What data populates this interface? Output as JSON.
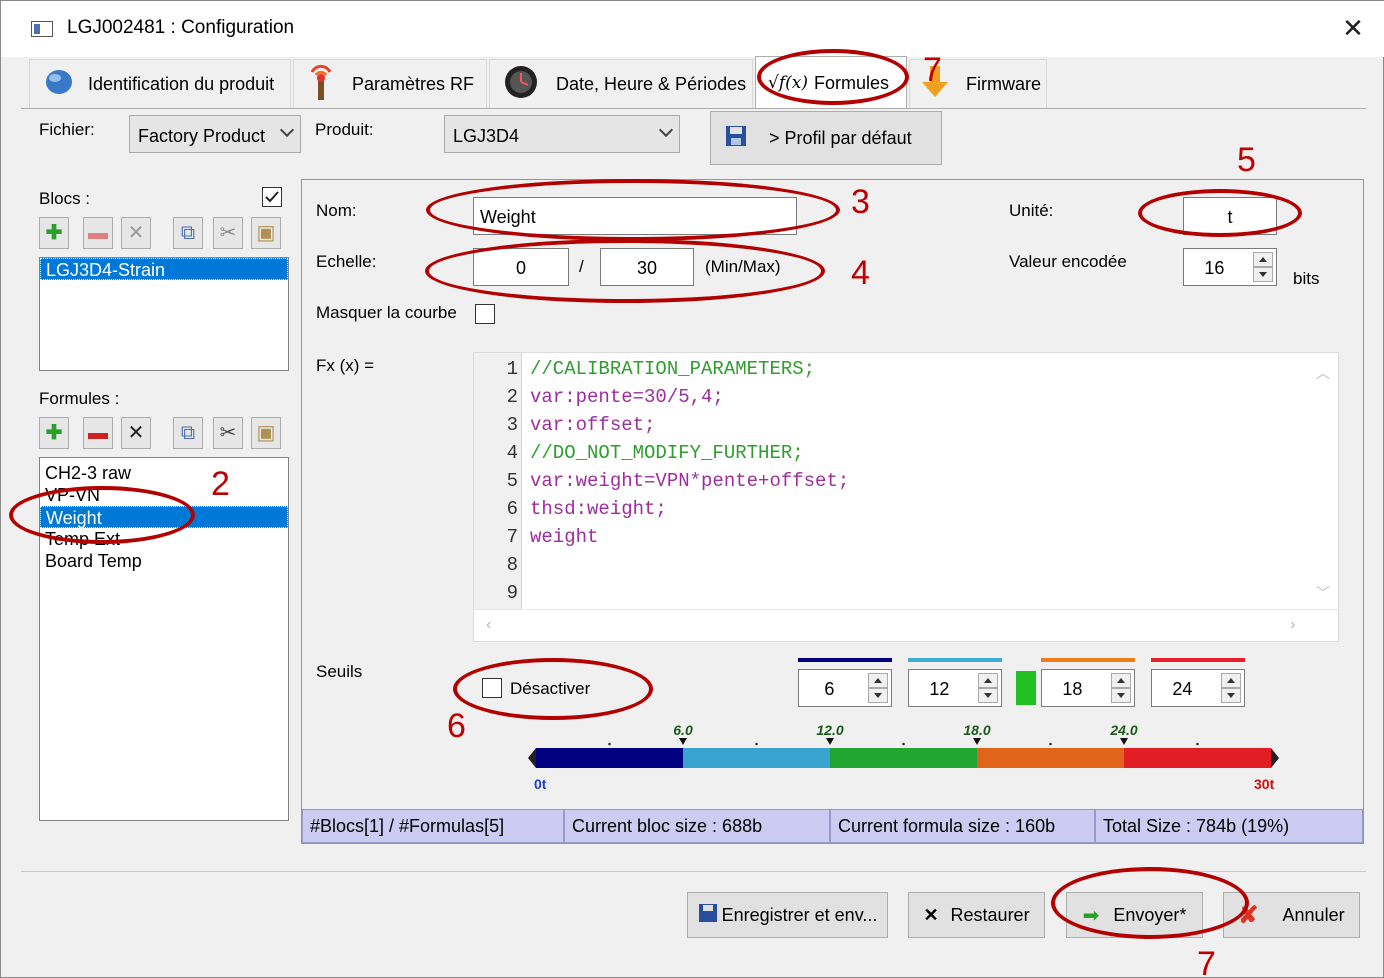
{
  "window": {
    "title": "LGJ002481 : Configuration"
  },
  "tabs": [
    {
      "label": "Identification du produit",
      "icon": "globe-icon"
    },
    {
      "label": "Paramètres RF",
      "icon": "antenna-icon"
    },
    {
      "label": "Date, Heure & Périodes",
      "icon": "clock-icon"
    },
    {
      "label": "Formules",
      "icon": "sqrt-fx-icon",
      "icon_text": "√f(x)"
    },
    {
      "label": "Firmware",
      "icon": "download-arrow-icon"
    }
  ],
  "toolbar": {
    "fichier_label": "Fichier:",
    "fichier_value": "Factory Product",
    "produit_label": "Produit:",
    "produit_value": "LGJ3D4",
    "profile_button": "> Profil par défaut"
  },
  "blocs": {
    "label": "Blocs :",
    "items": [
      "LGJ3D4-Strain"
    ]
  },
  "formules": {
    "label": "Formules :",
    "items": [
      "CH2-3 raw",
      "VP-VN",
      "Weight",
      "Temp Ext",
      "Board Temp"
    ],
    "selected": "Weight"
  },
  "form": {
    "nom_label": "Nom:",
    "nom_value": "Weight",
    "unite_label": "Unité:",
    "unite_value": "t",
    "echelle_label": "Echelle:",
    "echelle_min": "0",
    "echelle_sep": "/",
    "echelle_max": "30",
    "echelle_hint": "(Min/Max)",
    "valeur_label": "Valeur encodée",
    "valeur_value": "16",
    "valeur_unit": "bits",
    "masquer_label": "Masquer la courbe",
    "fx_label": "Fx (x) ="
  },
  "code": {
    "lines": [
      {
        "n": "1",
        "text": "//CALIBRATION_PARAMETERS;"
      },
      {
        "n": "2",
        "text": "var:pente=30/5,4;"
      },
      {
        "n": "3",
        "text": "var:offset;"
      },
      {
        "n": "4",
        "text": "//DO_NOT_MODIFY_FURTHER;"
      },
      {
        "n": "5",
        "text": "var:weight=VPN*pente+offset;"
      },
      {
        "n": "6",
        "text": "thsd:weight;"
      },
      {
        "n": "7",
        "text": "weight"
      },
      {
        "n": "8",
        "text": ""
      },
      {
        "n": "9",
        "text": ""
      }
    ]
  },
  "seuils": {
    "label": "Seuils",
    "disable_label": "Désactiver",
    "thresholds": [
      {
        "value": "6",
        "color": "#000080"
      },
      {
        "value": "12",
        "color": "#3eaad6"
      },
      {
        "value": "18",
        "color": "#f07c1c"
      },
      {
        "value": "24",
        "color": "#e8202a"
      }
    ],
    "indicator_color": "#22c022",
    "bar_ticks": [
      "6.0",
      "12.0",
      "18.0",
      "24.0"
    ],
    "bar_min": "0t",
    "bar_max": "30t",
    "bar_colors": [
      "#000080",
      "#3aa4d0",
      "#22a632",
      "#e0641a",
      "#e01e24"
    ]
  },
  "status": {
    "cells": [
      "#Blocs[1] / #Formulas[5]",
      "Current bloc size : 688b",
      "Current formula size : 160b",
      "Total Size : 784b (19%)"
    ]
  },
  "buttons": {
    "save": "Enregistrer et env...",
    "restore": "Restaurer",
    "send": "Envoyer*",
    "cancel": "Annuler"
  },
  "annotations": [
    "2",
    "3",
    "4",
    "5",
    "6",
    "7"
  ]
}
